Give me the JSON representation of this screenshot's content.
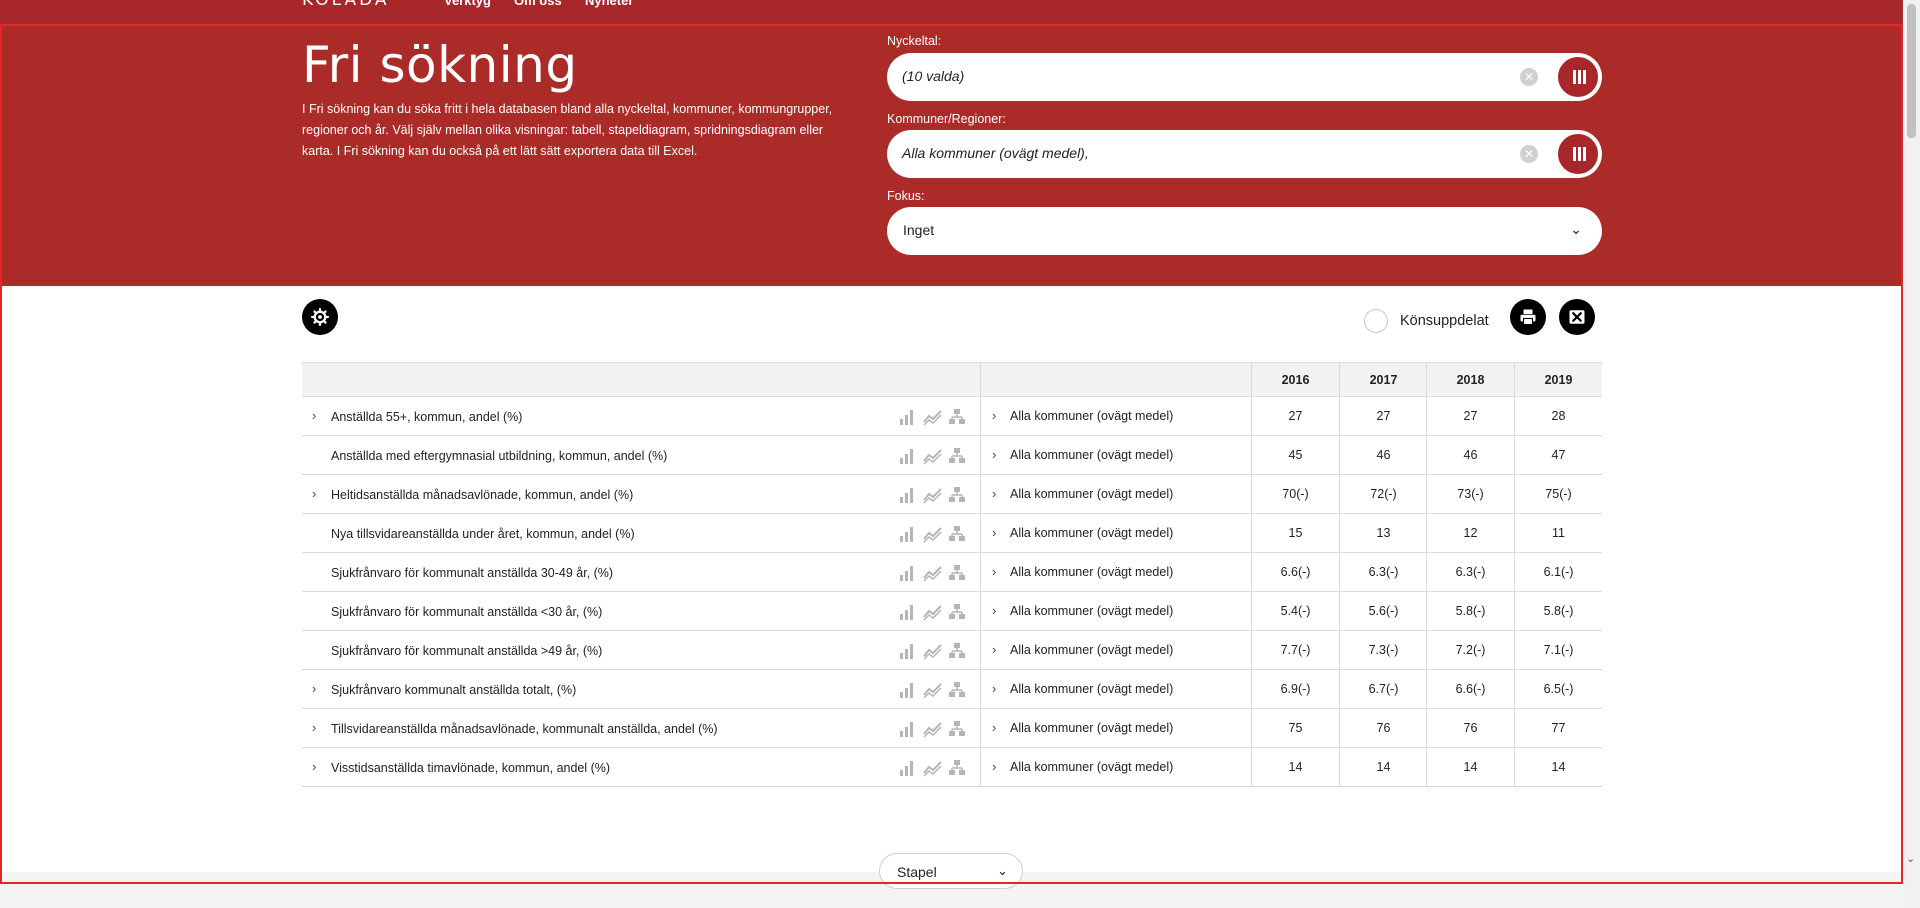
{
  "topnav": {
    "logo": "KOLADA",
    "links": [
      "Verktyg",
      "Om oss",
      "Nyheter"
    ]
  },
  "hero": {
    "title": "Fri sökning",
    "description": "I Fri sökning kan du söka fritt i hela databasen bland alla nyckeltal, kommuner, kommungrupper, regioner och år. Välj själv mellan olika visningar: tabell, stapeldiagram, spridningsdiagram eller karta. I Fri sökning kan du också på ett lätt sätt exportera data till Excel."
  },
  "filters": {
    "nyckeltal_label": "Nyckeltal:",
    "nyckeltal_value": "(10 valda)",
    "kommuner_label": "Kommuner/Regioner:",
    "kommuner_value": "Alla kommuner (ovägt medel),",
    "fokus_label": "Fokus:",
    "fokus_value": "Inget"
  },
  "toolbar": {
    "settings_icon": "gear-icon",
    "gender_split_label": "Könsuppdelat",
    "print_icon": "print-icon",
    "excel_icon": "excel-icon"
  },
  "table": {
    "years": [
      "2016",
      "2017",
      "2018",
      "2019"
    ],
    "rows": [
      {
        "expand": "›",
        "kpi": "Anställda 55+, kommun, andel (%)",
        "mun": "Alla kommuner (ovägt medel)",
        "values": [
          "27",
          "27",
          "27",
          "28"
        ]
      },
      {
        "expand": "",
        "kpi": "Anställda med eftergymnasial utbildning, kommun, andel (%)",
        "mun": "Alla kommuner (ovägt medel)",
        "values": [
          "45",
          "46",
          "46",
          "47"
        ]
      },
      {
        "expand": "›",
        "kpi": "Heltidsanställda månadsavlönade, kommun, andel (%)",
        "mun": "Alla kommuner (ovägt medel)",
        "values": [
          "70(-)",
          "72(-)",
          "73(-)",
          "75(-)"
        ]
      },
      {
        "expand": "",
        "kpi": "Nya tillsvidareanställda under året, kommun, andel (%)",
        "mun": "Alla kommuner (ovägt medel)",
        "values": [
          "15",
          "13",
          "12",
          "11"
        ]
      },
      {
        "expand": "",
        "kpi": "Sjukfrånvaro för kommunalt anställda 30-49 år, (%)",
        "mun": "Alla kommuner (ovägt medel)",
        "values": [
          "6.6(-)",
          "6.3(-)",
          "6.3(-)",
          "6.1(-)"
        ]
      },
      {
        "expand": "",
        "kpi": "Sjukfrånvaro för kommunalt anställda <30 år, (%)",
        "mun": "Alla kommuner (ovägt medel)",
        "values": [
          "5.4(-)",
          "5.6(-)",
          "5.8(-)",
          "5.8(-)"
        ]
      },
      {
        "expand": "",
        "kpi": "Sjukfrånvaro för kommunalt anställda >49 år, (%)",
        "mun": "Alla kommuner (ovägt medel)",
        "values": [
          "7.7(-)",
          "7.3(-)",
          "7.2(-)",
          "7.1(-)"
        ]
      },
      {
        "expand": "›",
        "kpi": "Sjukfrånvaro kommunalt anställda totalt, (%)",
        "mun": "Alla kommuner (ovägt medel)",
        "values": [
          "6.9(-)",
          "6.7(-)",
          "6.6(-)",
          "6.5(-)"
        ]
      },
      {
        "expand": "›",
        "kpi": "Tillsvidareanställda månadsavlönade, kommunalt anställda, andel (%)",
        "mun": "Alla kommuner (ovägt medel)",
        "values": [
          "75",
          "76",
          "76",
          "77"
        ]
      },
      {
        "expand": "›",
        "kpi": "Visstidsanställda timavlönade, kommun, andel (%)",
        "mun": "Alla kommuner (ovägt medel)",
        "values": [
          "14",
          "14",
          "14",
          "14"
        ]
      }
    ],
    "row_icons": [
      "bar-chart-icon",
      "trend-icon",
      "hierarchy-icon"
    ]
  },
  "view": {
    "selected": "Stapel"
  },
  "colors": {
    "brand_red": "#ab2b28",
    "button_black": "#000000",
    "row_border": "#dcdcdc"
  }
}
